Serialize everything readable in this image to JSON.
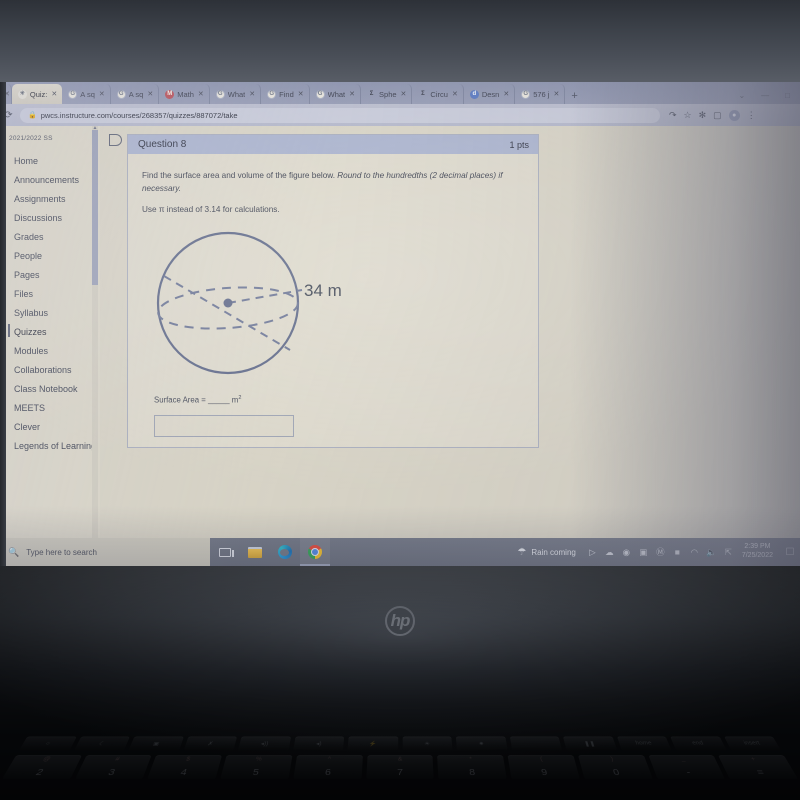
{
  "browser": {
    "tabs": [
      {
        "icon": "partial-tab",
        "label": "",
        "partial": true
      },
      {
        "icon": "canvas-icon",
        "label": "Quiz:",
        "active": true
      },
      {
        "icon": "google-icon",
        "label": "A sq",
        "active": false
      },
      {
        "icon": "google-icon",
        "label": "A sq",
        "active": false
      },
      {
        "icon": "math-icon",
        "label": "Math",
        "active": false
      },
      {
        "icon": "google-icon",
        "label": "What",
        "active": false
      },
      {
        "icon": "google-icon",
        "label": "Find",
        "active": false
      },
      {
        "icon": "google-icon",
        "label": "What",
        "active": false
      },
      {
        "icon": "sigma-icon",
        "label": "Sphe",
        "active": false
      },
      {
        "icon": "sigma-icon",
        "label": "Circu",
        "active": false
      },
      {
        "icon": "doc-icon",
        "label": "Desn",
        "active": false
      },
      {
        "icon": "google-icon",
        "label": "576 j",
        "active": false
      }
    ],
    "new_tab_label": "+",
    "window_controls": {
      "minimize": "—",
      "maximize": "□",
      "tab_search": "⌄"
    },
    "nav": {
      "reload": "⟳"
    },
    "omnibox": {
      "lock_icon": "lock-icon",
      "url": "pwcs.instructure.com/courses/268357/quizzes/887072/take"
    },
    "toolbar_icons": [
      "share-icon",
      "bookmark-star-icon",
      "extensions-icon",
      "side-panel-icon",
      "profile-avatar-icon",
      "chrome-menu-icon"
    ]
  },
  "sidebar": {
    "term": "2021/2022 SS",
    "items": [
      {
        "label": "Home",
        "active": false
      },
      {
        "label": "Announcements",
        "active": false
      },
      {
        "label": "Assignments",
        "active": false
      },
      {
        "label": "Discussions",
        "active": false
      },
      {
        "label": "Grades",
        "active": false
      },
      {
        "label": "People",
        "active": false
      },
      {
        "label": "Pages",
        "active": false
      },
      {
        "label": "Files",
        "active": false
      },
      {
        "label": "Syllabus",
        "active": false
      },
      {
        "label": "Quizzes",
        "active": true
      },
      {
        "label": "Modules",
        "active": false
      },
      {
        "label": "Collaborations",
        "active": false
      },
      {
        "label": "Class Notebook",
        "active": false
      },
      {
        "label": "MEETS",
        "active": false
      },
      {
        "label": "Clever",
        "active": false
      },
      {
        "label": "Legends of Learning",
        "active": false
      }
    ]
  },
  "question": {
    "title": "Question 8",
    "points": "1 pts",
    "prompt_part1": "Find the surface area and volume of the figure below.",
    "prompt_emphasis": "Round to the hundredths (2 decimal places) if necessary.",
    "prompt_part2": "Use π instead of 3.14 for calculations.",
    "answer_label": "Surface Area = _____ m",
    "answer_exponent": "2",
    "answer_value": "",
    "answer_placeholder": ""
  },
  "figure": {
    "shape": "sphere",
    "measurement_label": "34 m",
    "measurement_type": "radius",
    "stroke_color": "#5d6787",
    "center_dot": true
  },
  "taskbar": {
    "search_placeholder": "Type here to search",
    "search_icon": "magnifier-icon",
    "buttons": [
      {
        "name": "task-view",
        "icon": "task-view-icon"
      },
      {
        "name": "file-explorer",
        "icon": "file-explorer-icon"
      },
      {
        "name": "microsoft-edge",
        "icon": "edge-icon"
      },
      {
        "name": "google-chrome",
        "icon": "chrome-icon",
        "running": true
      }
    ],
    "weather": {
      "icon": "rain-cloud-icon",
      "text": "Rain coming"
    },
    "tray_icons": [
      "show-hidden-icons-icon",
      "onedrive-icon",
      "globe-icon",
      "security-icon",
      "bluetooth-icon",
      "battery-icon",
      "wifi-icon",
      "volume-icon",
      "touchpad-icon"
    ],
    "clock": {
      "time": "2:39 PM",
      "date": "7/25/2022"
    },
    "notification_icon": "notification-icon"
  },
  "hardware": {
    "brand_logo": "hp",
    "keyboard_fn_row": [
      "☼",
      "□",
      "✇",
      "◁))",
      "◁)",
      "⚡",
      "☀",
      "✹",
      "",
      "❚❚",
      "home",
      "end",
      "insert"
    ],
    "keyboard_number_row": [
      {
        "shifted": "@",
        "key": "2"
      },
      {
        "shifted": "#",
        "key": "3"
      },
      {
        "shifted": "$",
        "key": "4"
      },
      {
        "shifted": "%",
        "key": "5"
      },
      {
        "shifted": "^",
        "key": "6"
      },
      {
        "shifted": "&",
        "key": "7"
      },
      {
        "shifted": "*",
        "key": "8"
      },
      {
        "shifted": "(",
        "key": "9"
      },
      {
        "shifted": ")",
        "key": "0"
      },
      {
        "shifted": "_",
        "key": "-"
      },
      {
        "shifted": "+",
        "key": "="
      }
    ]
  }
}
